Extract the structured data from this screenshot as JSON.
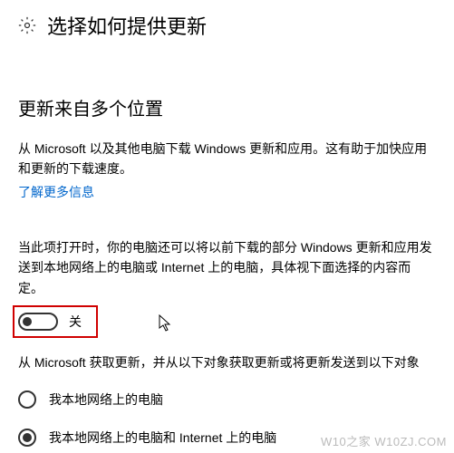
{
  "header": {
    "title": "选择如何提供更新"
  },
  "section": {
    "subtitle": "更新来自多个位置",
    "desc1": "从 Microsoft 以及其他电脑下载 Windows 更新和应用。这有助于加快应用和更新的下载速度。",
    "learn_more": "了解更多信息",
    "desc2": "当此项打开时，你的电脑还可以将以前下载的部分 Windows 更新和应用发送到本地网络上的电脑或 Internet 上的电脑，具体视下面选择的内容而定。"
  },
  "toggle": {
    "state": "off",
    "label": "关"
  },
  "radio": {
    "intro": "从 Microsoft 获取更新，并从以下对象获取更新或将更新发送到以下对象",
    "options": [
      {
        "label": "我本地网络上的电脑",
        "selected": false
      },
      {
        "label": "我本地网络上的电脑和 Internet 上的电脑",
        "selected": true
      }
    ]
  },
  "watermark": "W10之家 W10ZJ.COM"
}
